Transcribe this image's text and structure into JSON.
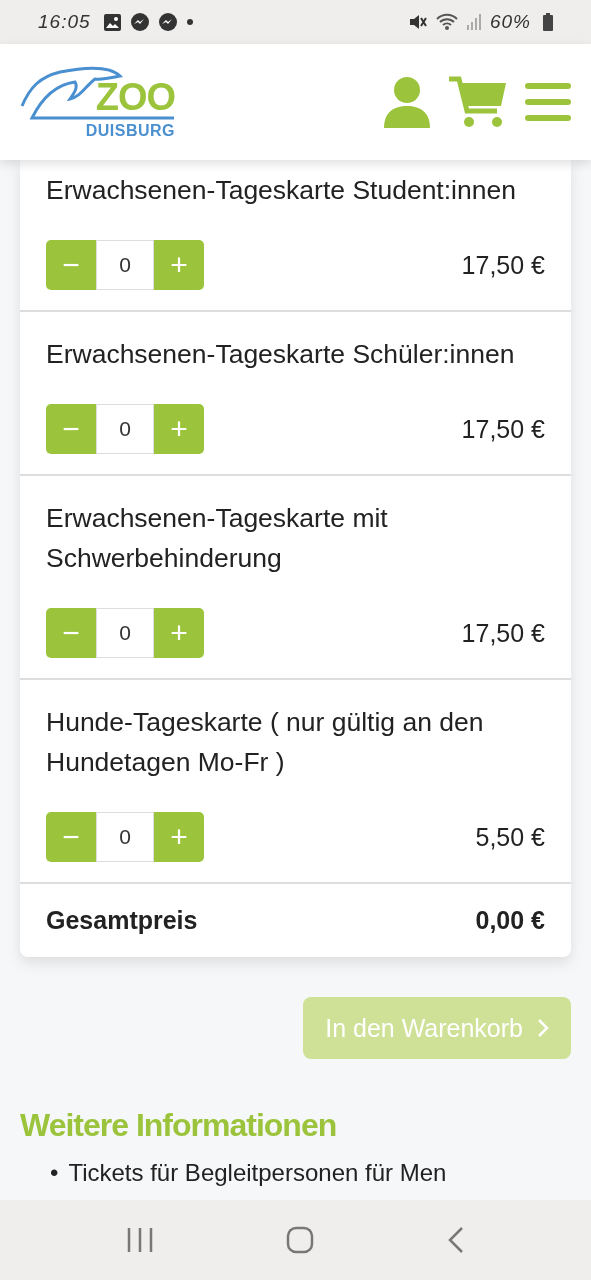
{
  "status_bar": {
    "time": "16:05",
    "battery": "60%"
  },
  "header": {
    "logo": {
      "name": "ZOO",
      "subtitle": "DUISBURG"
    }
  },
  "tickets": [
    {
      "title": "Erwachsenen-Tageskarte Student:innen",
      "minus": "−",
      "quantity": "0",
      "plus": "+",
      "price": "17,50 €"
    },
    {
      "title": "Erwachsenen-Tageskarte Schüler:innen",
      "minus": "−",
      "quantity": "0",
      "plus": "+",
      "price": "17,50 €"
    },
    {
      "title": "Erwachsenen-Tageskarte mit Schwerbehinderung",
      "minus": "−",
      "quantity": "0",
      "plus": "+",
      "price": "17,50 €"
    },
    {
      "title": "Hunde-Tageskarte ( nur gültig an den Hundetagen Mo-Fr )",
      "minus": "−",
      "quantity": "0",
      "plus": "+",
      "price": "5,50 €"
    }
  ],
  "total": {
    "label": "Gesamtpreis",
    "value": "0,00 €"
  },
  "cart_button": {
    "label": "In den Warenkorb",
    "disabled": true
  },
  "info": {
    "heading": "Weitere Informationen",
    "items": [
      {
        "marker": "•",
        "text": "Tickets für Begleitpersonen für Men"
      }
    ]
  }
}
